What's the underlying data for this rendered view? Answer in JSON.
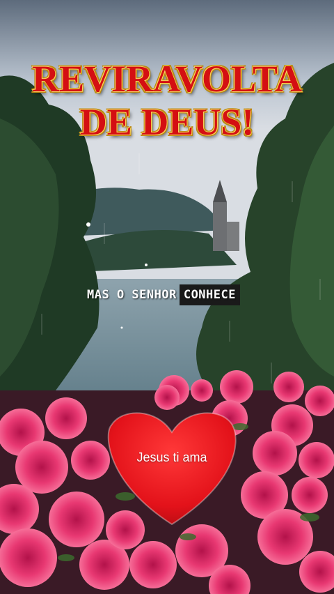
{
  "title": {
    "line1": "REVIRAVOLTA",
    "line2": "DE DEUS!"
  },
  "caption": {
    "part1": "MAS O SENHOR",
    "part2": "CONHECE"
  },
  "heart": {
    "label": "Jesus ti ama"
  },
  "colors": {
    "title": "#d40f12",
    "heart": "#e8141c",
    "flowers": "#e8336b"
  }
}
